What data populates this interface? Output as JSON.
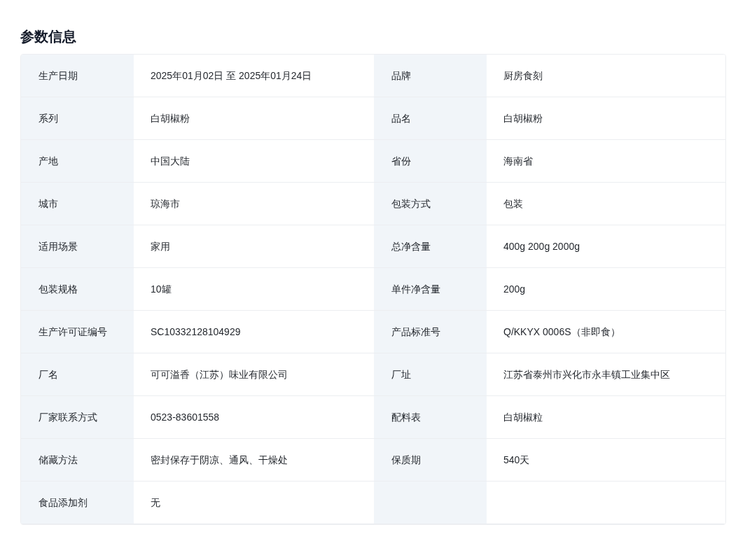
{
  "title": "参数信息",
  "params": [
    {
      "label": "生产日期",
      "value": "2025年01月02日 至 2025年01月24日"
    },
    {
      "label": "品牌",
      "value": "厨房食刻"
    },
    {
      "label": "系列",
      "value": "白胡椒粉"
    },
    {
      "label": "品名",
      "value": "白胡椒粉"
    },
    {
      "label": "产地",
      "value": "中国大陆"
    },
    {
      "label": "省份",
      "value": "海南省"
    },
    {
      "label": "城市",
      "value": "琼海市"
    },
    {
      "label": "包装方式",
      "value": "包装"
    },
    {
      "label": "适用场景",
      "value": "家用"
    },
    {
      "label": "总净含量",
      "value": "400g 200g 2000g"
    },
    {
      "label": "包装规格",
      "value": "10罐"
    },
    {
      "label": "单件净含量",
      "value": "200g"
    },
    {
      "label": "生产许可证编号",
      "value": "SC10332128104929"
    },
    {
      "label": "产品标准号",
      "value": "Q/KKYX 0006S（非即食）"
    },
    {
      "label": "厂名",
      "value": "可可溢香（江苏）味业有限公司"
    },
    {
      "label": "厂址",
      "value": "江苏省泰州市兴化市永丰镇工业集中区"
    },
    {
      "label": "厂家联系方式",
      "value": "0523-83601558"
    },
    {
      "label": "配料表",
      "value": "白胡椒粒"
    },
    {
      "label": "储藏方法",
      "value": "密封保存于阴凉、通风、干燥处"
    },
    {
      "label": "保质期",
      "value": "540天"
    },
    {
      "label": "食品添加剂",
      "value": "无"
    }
  ]
}
